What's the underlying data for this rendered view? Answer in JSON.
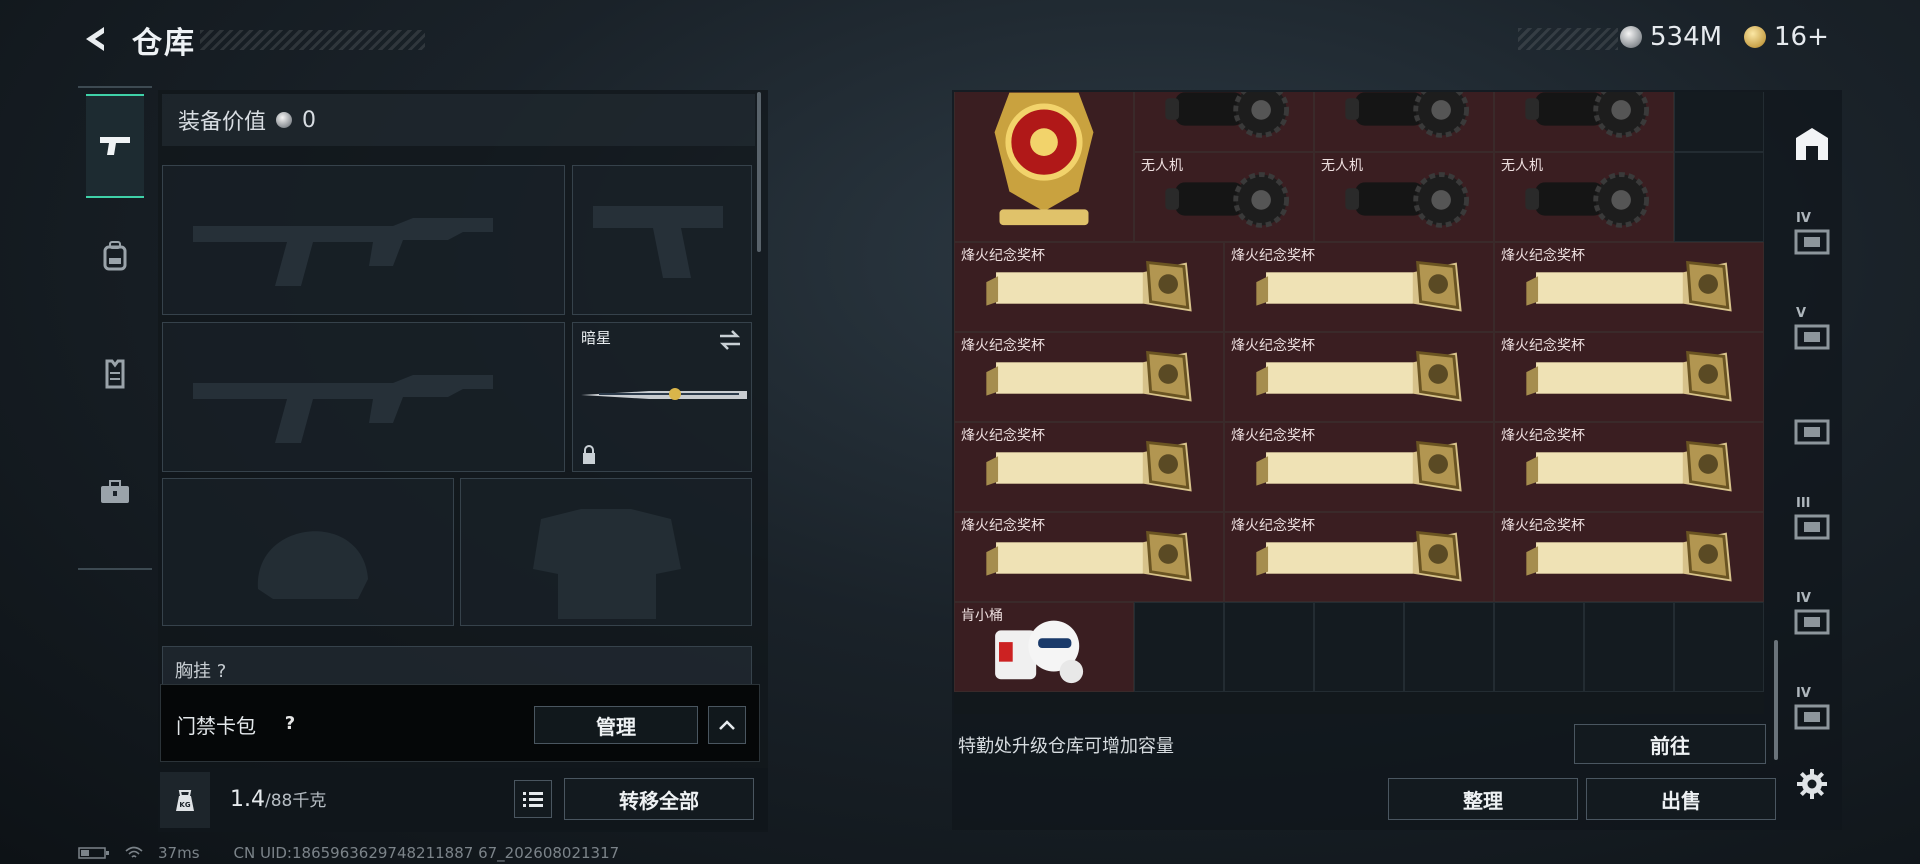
{
  "header": {
    "title": "仓库",
    "currency_silver": "534M",
    "currency_gold": "16+"
  },
  "left_rail": [
    "gun-icon",
    "backpack-icon",
    "vest-icon",
    "toolbox-icon"
  ],
  "equipment": {
    "value_label": "装备价值",
    "value": "0",
    "melee_label": "暗星",
    "chest_label": "胸挂",
    "chest_count": "?"
  },
  "keycard": {
    "label": "门禁卡包",
    "help": "?",
    "manage_label": "管理"
  },
  "weight": {
    "current": "1.4",
    "capacity": "/88千克",
    "transfer_all_label": "转移全部"
  },
  "status": {
    "ping": "37ms",
    "uid": "CN UID:1865963629748211887 67_202608021317"
  },
  "storage": {
    "items": [
      {
        "label": "阿萨拉勋章",
        "kind": "medal"
      },
      {
        "label": "无人机",
        "kind": "drone"
      },
      {
        "label": "无人机",
        "kind": "drone"
      },
      {
        "label": "无人机",
        "kind": "drone"
      },
      {
        "label": "无人机",
        "kind": "drone"
      },
      {
        "label": "无人机",
        "kind": "drone"
      },
      {
        "label": "无人机",
        "kind": "drone"
      },
      {
        "label": "烽火纪念奖杯",
        "kind": "trophy"
      },
      {
        "label": "烽火纪念奖杯",
        "kind": "trophy"
      },
      {
        "label": "烽火纪念奖杯",
        "kind": "trophy"
      },
      {
        "label": "烽火纪念奖杯",
        "kind": "trophy"
      },
      {
        "label": "烽火纪念奖杯",
        "kind": "trophy"
      },
      {
        "label": "烽火纪念奖杯",
        "kind": "trophy"
      },
      {
        "label": "烽火纪念奖杯",
        "kind": "trophy"
      },
      {
        "label": "烽火纪念奖杯",
        "kind": "trophy"
      },
      {
        "label": "烽火纪念奖杯",
        "kind": "trophy"
      },
      {
        "label": "烽火纪念奖杯",
        "kind": "trophy"
      },
      {
        "label": "烽火纪念奖杯",
        "kind": "trophy"
      },
      {
        "label": "烽火纪念奖杯",
        "kind": "trophy"
      },
      {
        "label": "肯小桶",
        "kind": "toy"
      }
    ],
    "hint": "特勤处升级仓库可增加容量",
    "goto_label": "前往",
    "sort_label": "整理",
    "sell_label": "出售"
  },
  "right_rail": [
    {
      "name": "storage-tab-main-icon",
      "tier": ""
    },
    {
      "name": "storage-tab-iv-icon",
      "tier": "IV"
    },
    {
      "name": "storage-tab-v-icon",
      "tier": "V"
    },
    {
      "name": "storage-tab-ii-icon",
      "tier": ""
    },
    {
      "name": "storage-tab-iii-icon",
      "tier": "III"
    },
    {
      "name": "storage-tab-iv-b-icon",
      "tier": "IV"
    },
    {
      "name": "storage-tab-iv-c-icon",
      "tier": "IV"
    }
  ],
  "colors": {
    "accent": "#3fd1a8",
    "item_cell_bg": "#3a1e21"
  }
}
